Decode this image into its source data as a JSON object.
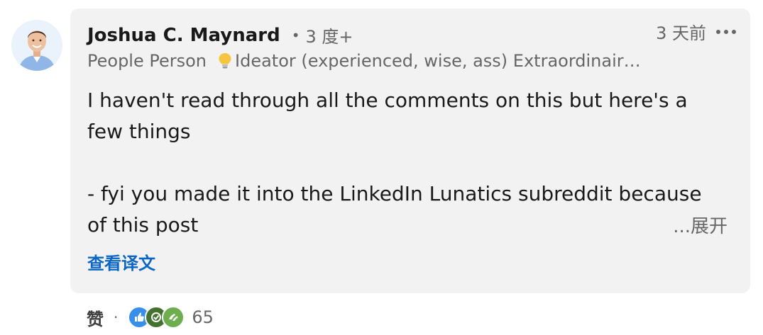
{
  "author": {
    "name": "Joshua C. Maynard",
    "degree_dot": "•",
    "degree": "3 度+",
    "headline_part1": "People Person",
    "headline_part2": "Ideator (experienced, wise, ass) Extraordinair…"
  },
  "meta": {
    "time": "3 天前"
  },
  "comment": {
    "line1": "I haven't read through all the comments on this but here's a few things",
    "line2": "- fyi you made it into the LinkedIn Lunatics subreddit because of this post",
    "see_more": "...展开",
    "translate": "查看译文"
  },
  "actions": {
    "like": "赞",
    "separator": "·",
    "reaction_count": "65",
    "reactions": [
      "like-icon",
      "celebrate-icon",
      "support-icon"
    ]
  },
  "colors": {
    "card_bg": "#f2f2f2",
    "link": "#0a66c2",
    "secondary_text": "#666666",
    "primary_text": "#191919"
  }
}
